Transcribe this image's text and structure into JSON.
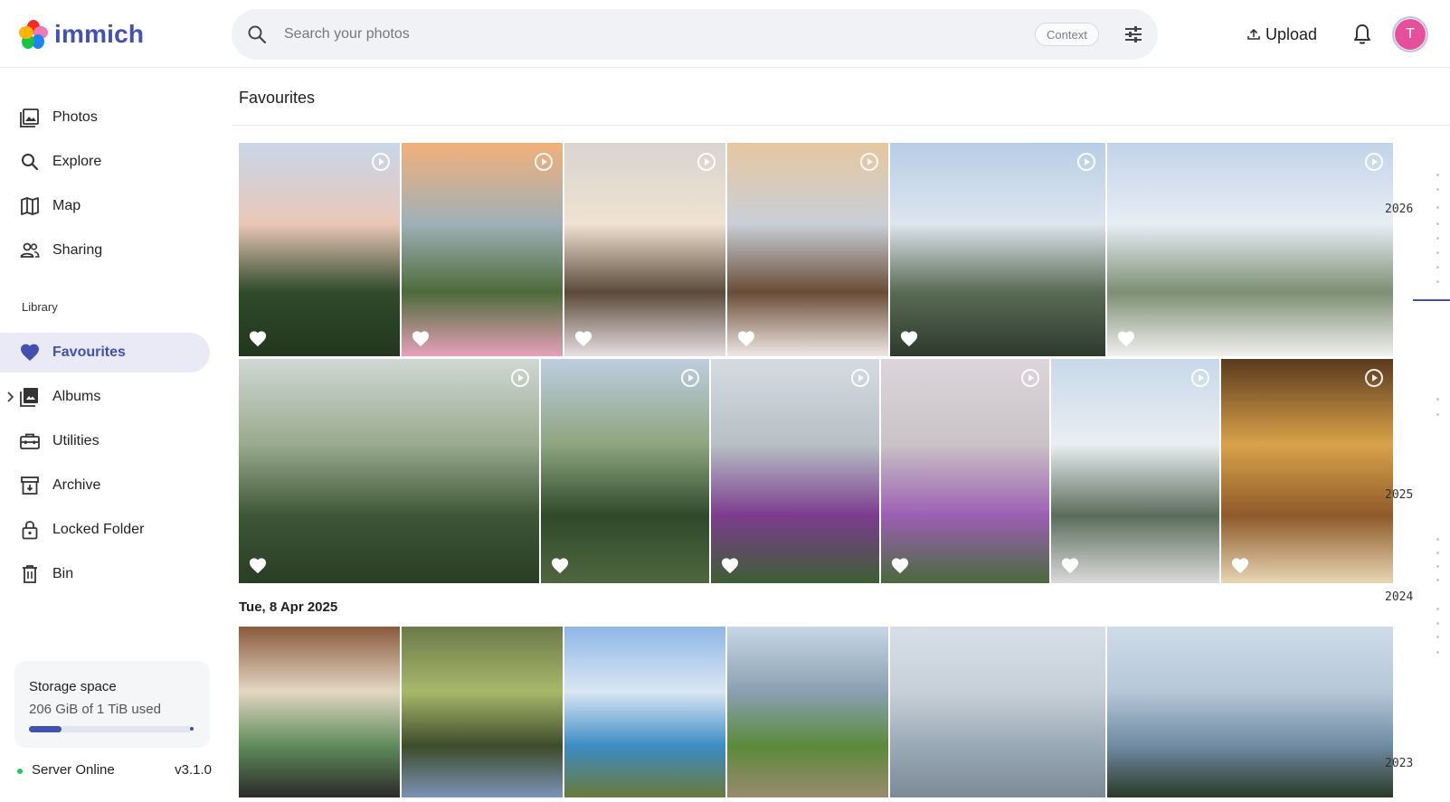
{
  "app": {
    "name": "immich"
  },
  "header": {
    "search_placeholder": "Search your photos",
    "context_label": "Context",
    "upload_label": "Upload",
    "avatar_initial": "T"
  },
  "sidebar": {
    "items": [
      {
        "label": "Photos",
        "icon": "photos-icon"
      },
      {
        "label": "Explore",
        "icon": "search-icon"
      },
      {
        "label": "Map",
        "icon": "map-icon"
      },
      {
        "label": "Sharing",
        "icon": "sharing-icon"
      }
    ],
    "library_label": "Library",
    "library_items": [
      {
        "label": "Favourites",
        "icon": "heart-icon",
        "active": true
      },
      {
        "label": "Albums",
        "icon": "albums-icon"
      },
      {
        "label": "Utilities",
        "icon": "toolbox-icon"
      },
      {
        "label": "Archive",
        "icon": "archive-icon"
      },
      {
        "label": "Locked Folder",
        "icon": "lock-icon"
      },
      {
        "label": "Bin",
        "icon": "trash-icon"
      }
    ],
    "storage": {
      "title": "Storage space",
      "usage": "206 GiB of 1 TiB used",
      "used_fraction": 0.2
    },
    "server": {
      "status": "Server Online",
      "version": "v3.1.0"
    }
  },
  "main": {
    "title": "Favourites",
    "date_group": "Tue, 8 Apr 2025",
    "accent_color": "#4250af"
  },
  "timeline": {
    "years": [
      "2026",
      "2025",
      "2024",
      "2023"
    ]
  }
}
